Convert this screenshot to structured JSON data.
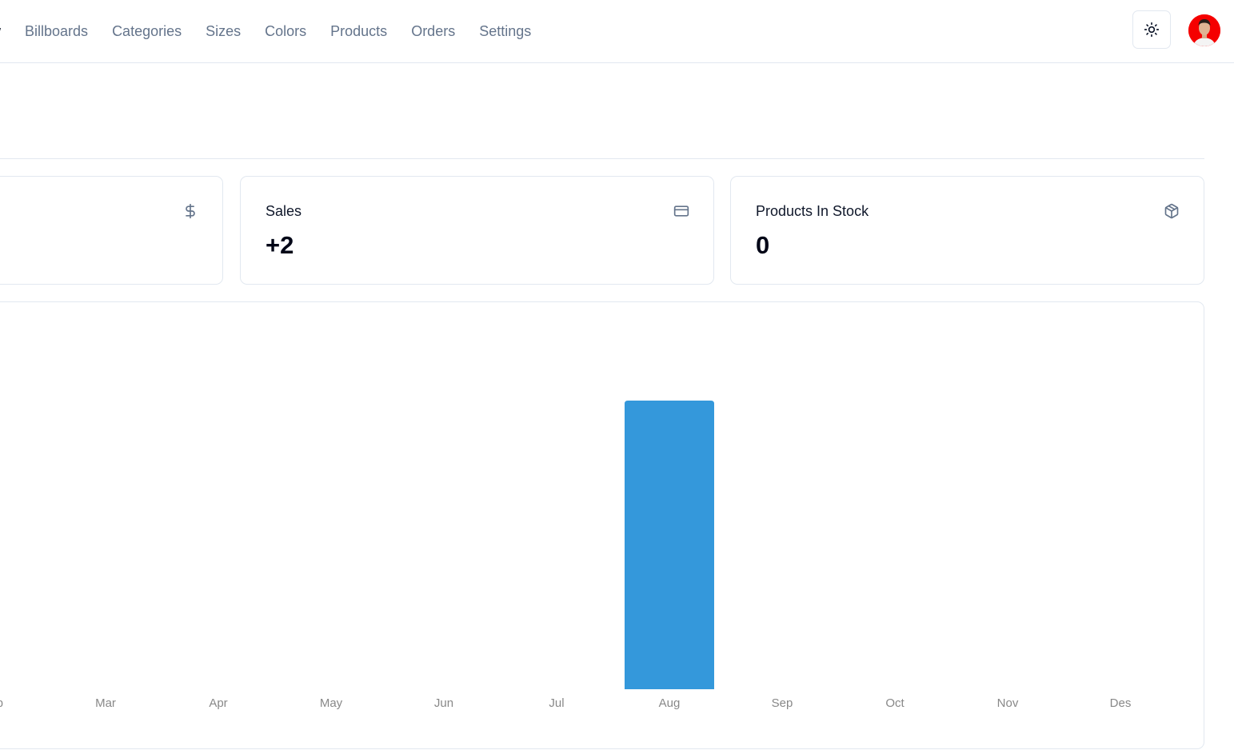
{
  "nav": {
    "items": [
      {
        "label": "Overview",
        "visible_text": "iew",
        "active": true
      },
      {
        "label": "Billboards",
        "active": false
      },
      {
        "label": "Categories",
        "active": false
      },
      {
        "label": "Sizes",
        "active": false
      },
      {
        "label": "Colors",
        "active": false
      },
      {
        "label": "Products",
        "active": false
      },
      {
        "label": "Orders",
        "active": false
      },
      {
        "label": "Settings",
        "active": false
      }
    ],
    "theme_toggle_icon": "sun-icon",
    "avatar_bg": "#f50000"
  },
  "cards": [
    {
      "title": "",
      "value": "",
      "icon": "dollar-sign-icon"
    },
    {
      "title": "Sales",
      "value": "+2",
      "icon": "credit-card-icon"
    },
    {
      "title": "Products In Stock",
      "value": "0",
      "icon": "package-icon"
    }
  ],
  "chart_data": {
    "type": "bar",
    "title": "",
    "xlabel": "",
    "ylabel": "",
    "categories": [
      "Feb",
      "Mar",
      "Apr",
      "May",
      "Jun",
      "Jul",
      "Aug",
      "Sep",
      "Oct",
      "Nov",
      "Des"
    ],
    "visible_category_text": {
      "Feb": "b"
    },
    "values": [
      0,
      0,
      0,
      0,
      0,
      0,
      1,
      0,
      0,
      0,
      0
    ],
    "ylim": [
      0,
      1
    ],
    "bar_color": "#3498db",
    "grid": false
  }
}
